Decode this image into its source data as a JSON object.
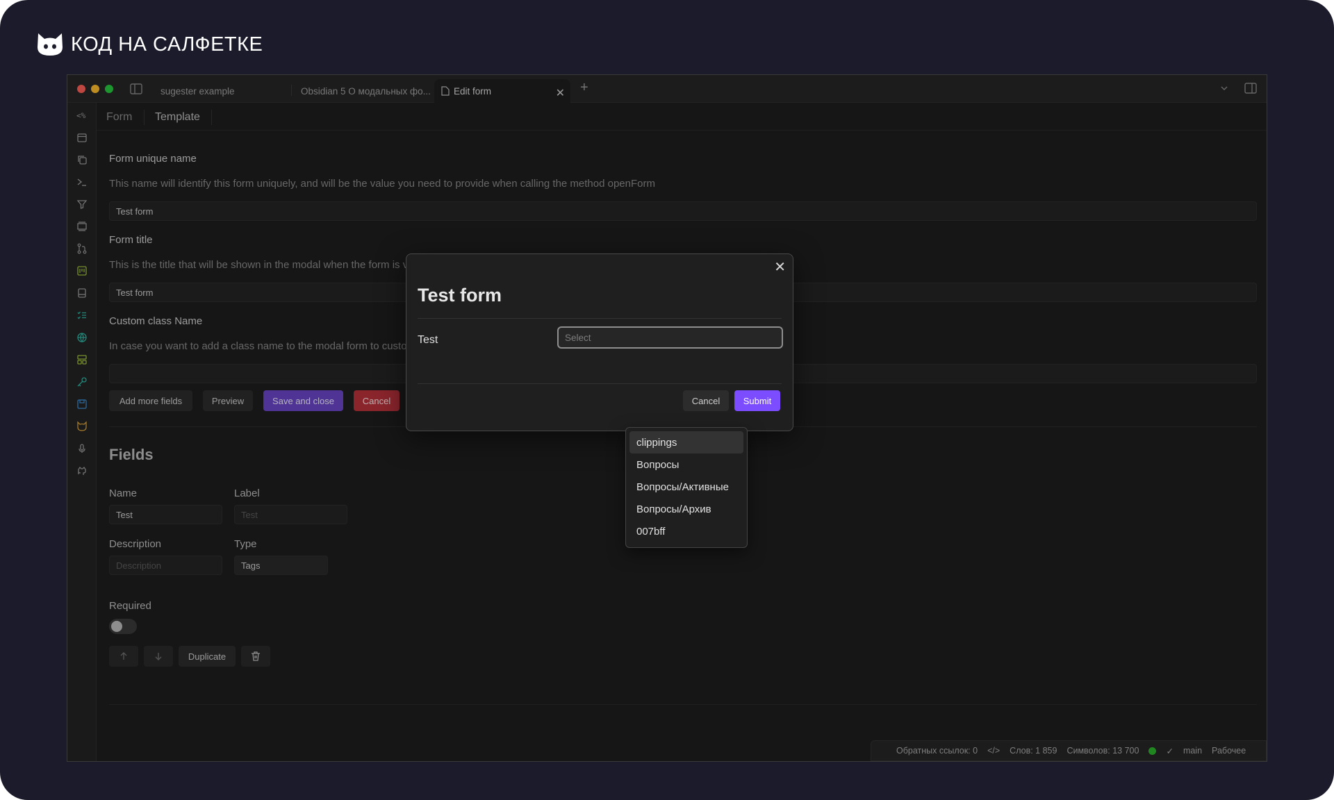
{
  "brand": {
    "text": "КОД НА САЛФЕТКЕ",
    "logo_icon": "cat-face-icon"
  },
  "titlebar": {
    "tabs": [
      {
        "label": "sugester example"
      },
      {
        "label": "Obsidian 5 О модальных фо..."
      },
      {
        "label": "Edit form"
      }
    ],
    "colors": {
      "close": "#ff5f57",
      "minimize": "#febc2e",
      "maximize": "#28c840"
    }
  },
  "ribbon": {
    "icons": [
      "code-icon",
      "calendar-icon",
      "copy-icon",
      "terminal-icon",
      "filter-icon",
      "layers-icon",
      "git-branch-icon",
      "kanban-icon",
      "bookmark-icon",
      "list-icon",
      "globe-icon",
      "layout-icon",
      "key-icon",
      "save-icon",
      "cat-icon",
      "mic-icon",
      "github-icon"
    ]
  },
  "view_header": {
    "tabs": [
      {
        "label": "Form"
      },
      {
        "label": "Template"
      }
    ]
  },
  "form": {
    "unique_name": {
      "label": "Form unique name",
      "description": "This name will identify this form uniquely, and will be the value you need to provide when calling the method openForm",
      "value": "Test form"
    },
    "title": {
      "label": "Form title",
      "description": "This is the title that will be shown in the modal when the form is visible",
      "value": "Test form"
    },
    "class_name": {
      "label": "Custom class Name",
      "description": "In case you want to add a class name to the modal form to customize it",
      "value": ""
    },
    "buttons": {
      "add_more": "Add more fields",
      "preview": "Preview",
      "save_close": "Save and close",
      "cancel": "Cancel"
    }
  },
  "fields": {
    "title": "Fields",
    "name_label": "Name",
    "name_value": "Test",
    "label_label": "Label",
    "label_placeholder": "Test",
    "description_label": "Description",
    "description_placeholder": "Description",
    "type_label": "Type",
    "type_value": "Tags",
    "required_label": "Required",
    "required_on": false,
    "duplicate_label": "Duplicate"
  },
  "status_bar": {
    "backlinks": "Обратных ссылок: 0",
    "words": "Слов: 1 859",
    "chars": "Символов: 13 700",
    "branch": "main",
    "workspace": "Рабочее"
  },
  "modal": {
    "title": "Test form",
    "field_label": "Test",
    "select_placeholder": "Select",
    "cancel": "Cancel",
    "submit": "Submit",
    "submit_color": "#7c4dff"
  },
  "dropdown": {
    "items": [
      "clippings",
      "Вопросы",
      "Вопросы/Активные",
      "Вопросы/Архив",
      "007bff"
    ],
    "active_index": 0
  }
}
